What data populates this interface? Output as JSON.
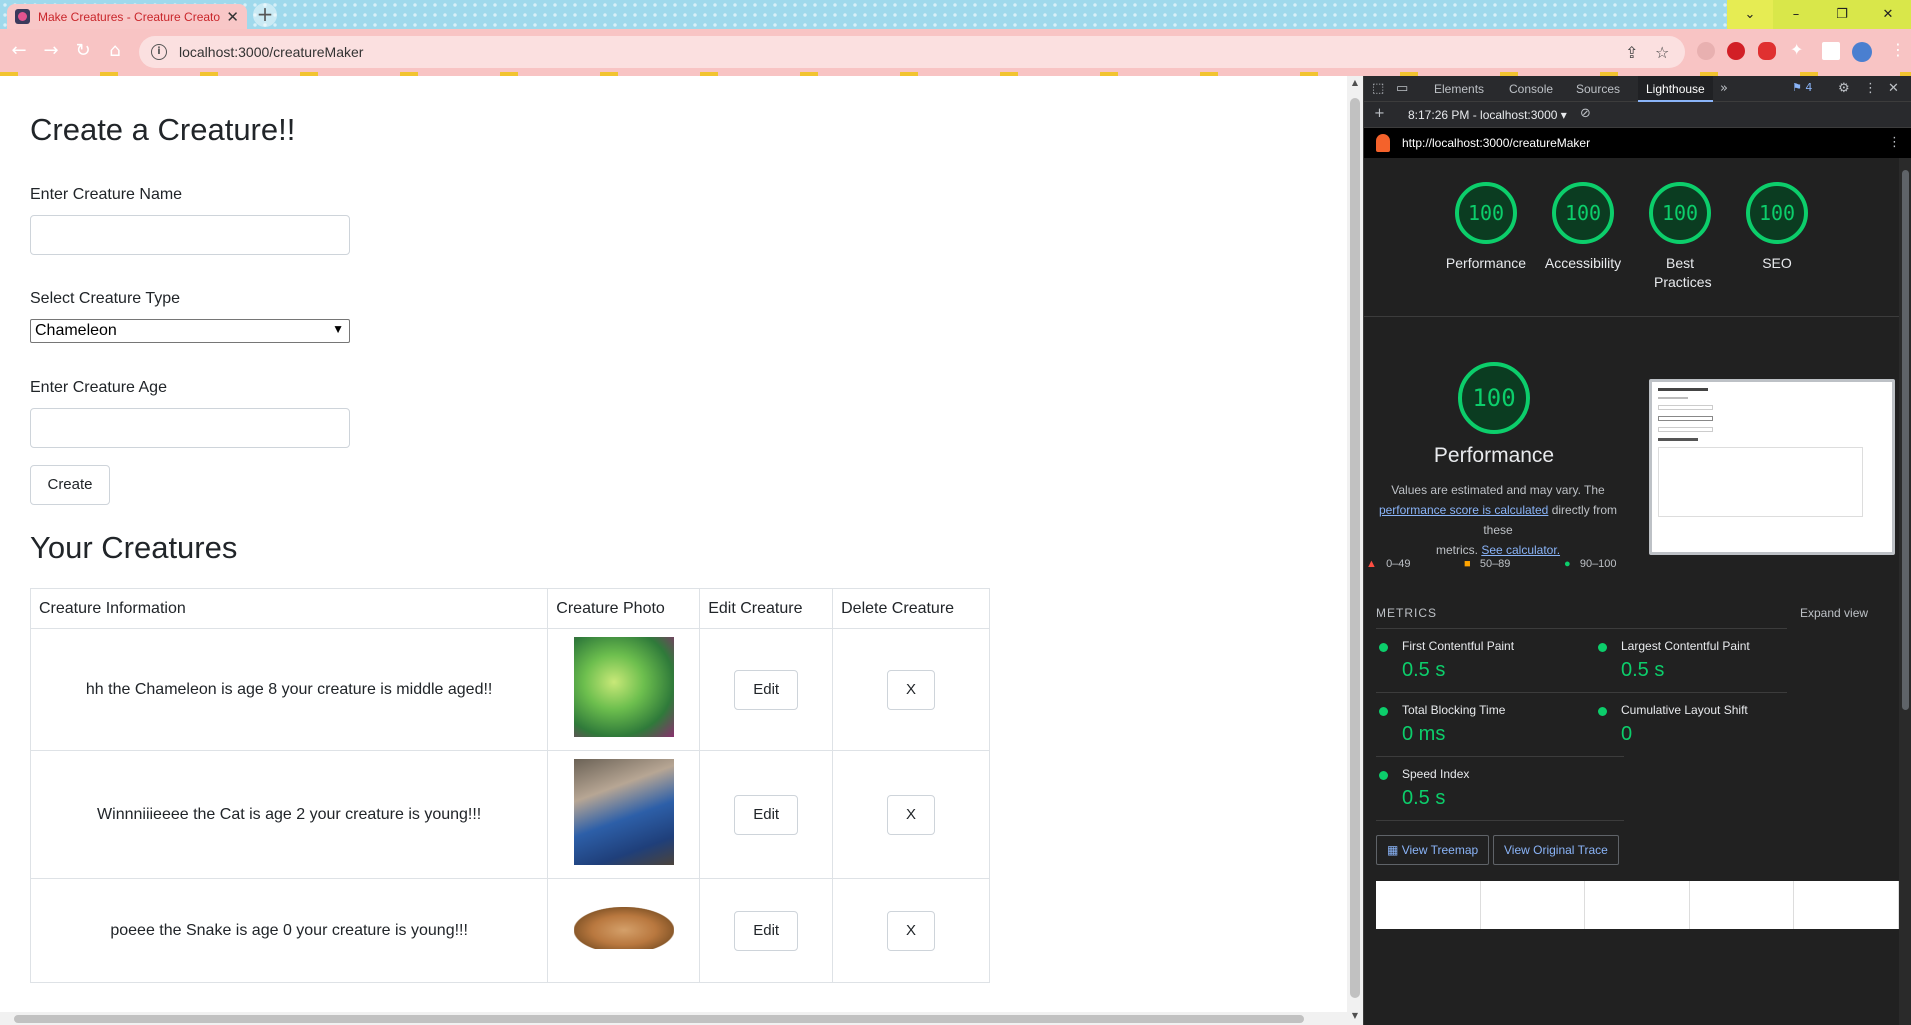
{
  "browser": {
    "tab_title": "Make Creatures - Creature Creator",
    "tab_close": "✕",
    "new_tab": "+",
    "url": "localhost:3000/creatureMaker",
    "window_controls": [
      "⌄",
      "–",
      "❐",
      "✕"
    ]
  },
  "page": {
    "title": "Create a Creature!!",
    "name_label": "Enter Creature Name",
    "name_value": "",
    "type_label": "Select Creature Type",
    "type_selected": "Chameleon",
    "age_label": "Enter Creature Age",
    "age_value": "",
    "create_button": "Create",
    "list_title": "Your Creatures",
    "table": {
      "headers": [
        "Creature Information",
        "Creature Photo",
        "Edit Creature",
        "Delete Creature"
      ],
      "rows": [
        {
          "info": "hh the Chameleon is age 8 your creature is middle aged!!",
          "photo": "chameleon-photo",
          "edit": "Edit",
          "delete": "X"
        },
        {
          "info": "Winnniiieeee the Cat is age 2 your creature is young!!!",
          "photo": "cat-photo",
          "edit": "Edit",
          "delete": "X"
        },
        {
          "info": "poeee the Snake is age 0 your creature is young!!!",
          "photo": "snake-photo",
          "edit": "Edit",
          "delete": "X"
        }
      ]
    }
  },
  "devtools": {
    "tabs": [
      "Elements",
      "Console",
      "Sources",
      "Lighthouse"
    ],
    "active_tab": "Lighthouse",
    "issues_count": "4",
    "report_time": "8:17:26 PM - localhost:3000",
    "report_url": "http://localhost:3000/creatureMaker",
    "scores": [
      {
        "label": "Performance",
        "score": "100"
      },
      {
        "label": "Accessibility",
        "score": "100"
      },
      {
        "label": "Best Practices",
        "score": "100"
      },
      {
        "label": "SEO",
        "score": "100"
      }
    ],
    "performance": {
      "score": "100",
      "title": "Performance",
      "desc_1": "Values are estimated and may vary. The",
      "desc_link": "performance score is calculated",
      "desc_2": "directly from these",
      "desc_3": "metrics.",
      "calc_link": "See calculator."
    },
    "legend": [
      "0–49",
      "50–89",
      "90–100"
    ],
    "metrics_title": "METRICS",
    "expand_view": "Expand view",
    "metrics": [
      {
        "name": "First Contentful Paint",
        "value": "0.5 s"
      },
      {
        "name": "Largest Contentful Paint",
        "value": "0.5 s"
      },
      {
        "name": "Total Blocking Time",
        "value": "0 ms"
      },
      {
        "name": "Cumulative Layout Shift",
        "value": "0"
      },
      {
        "name": "Speed Index",
        "value": "0.5 s"
      }
    ],
    "view_treemap": "View Treemap",
    "view_trace": "View Original Trace",
    "colors": {
      "pass": "#0cce6b",
      "average": "#ffa400",
      "fail": "#ff4e42"
    }
  }
}
